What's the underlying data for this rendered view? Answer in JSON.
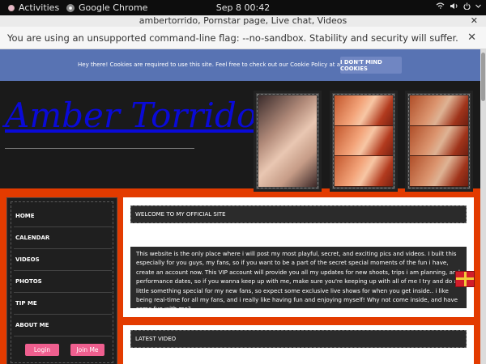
{
  "system_bar": {
    "activities": "Activities",
    "app_name": "Google Chrome",
    "clock": "Sep 8  00:42",
    "icons": [
      "network-icon",
      "volume-icon",
      "power-icon",
      "menu-arrow-icon"
    ]
  },
  "window": {
    "title": "ambertorrido, Pornstar page, Live chat, Videos",
    "close_glyph": "✕"
  },
  "infobar": {
    "message": "You are using an unsupported command-line flag: --no-sandbox. Stability and security will suffer.",
    "close_glyph": "✕"
  },
  "cookie": {
    "text": "Hey there! Cookies are required to use this site. Feel free to check out our Cookie Policy at any time.",
    "button": "I DON'T MIND COOKIES"
  },
  "site": {
    "title": "Amber Torrido"
  },
  "nav": {
    "items": [
      "HOME",
      "CALENDAR",
      "VIDEOS",
      "PHOTOS",
      "TIP ME",
      "ABOUT ME"
    ],
    "login": "Login",
    "join": "Join Me"
  },
  "main": {
    "welcome": "WELCOME TO MY OFFICIAL SITE",
    "intro": "This website is the only place where i will post my most playful, secret, and exciting pics and videos. I built this especially for you guys, my fans, so if you want to be a part of the secret special moments of the fun i have, create an account now. This VIP account will provide you all my updates for new shoots, trips i am planning, and performance dates, so if you wanna keep up with me, make sure you're keeping up with all of me I try and do a little something special for my new fans, so expect some exclusive live shows for when you get inside.. i like being real-time for all my fans, and i really like having fun and enjoying myself! Why not come inside, and have some fun with me?",
    "latest_video": "LATEST VIDEO"
  },
  "colors": {
    "page_bg": "#e33b00",
    "cookie_bg": "#5873b3",
    "title_link": "#0a0ad8",
    "pink_button": "#ef5f8f"
  }
}
